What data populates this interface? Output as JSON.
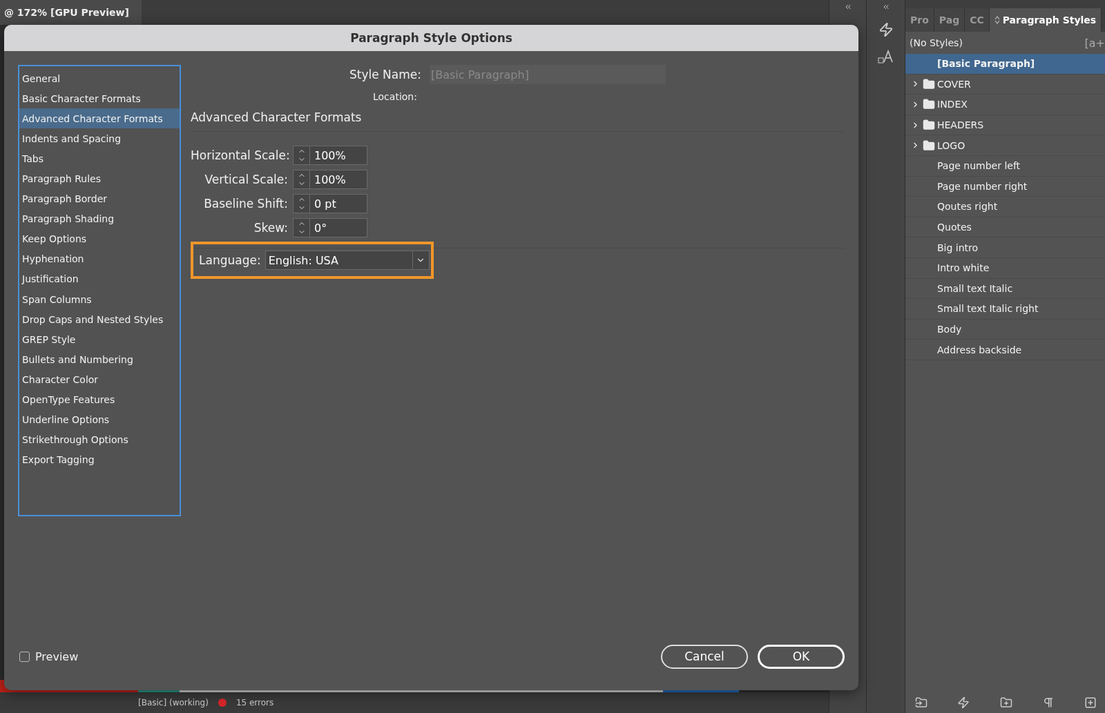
{
  "document_tab": {
    "title": "@ 172% [GPU Preview]"
  },
  "status_bar": {
    "profile": "[Basic] (working)",
    "errors": "15 errors"
  },
  "dialog": {
    "title": "Paragraph Style Options",
    "categories": [
      {
        "label": "General",
        "selected": false
      },
      {
        "label": "Basic Character Formats",
        "selected": false
      },
      {
        "label": "Advanced Character Formats",
        "selected": true
      },
      {
        "label": "Indents and Spacing",
        "selected": false
      },
      {
        "label": "Tabs",
        "selected": false
      },
      {
        "label": "Paragraph Rules",
        "selected": false
      },
      {
        "label": "Paragraph Border",
        "selected": false
      },
      {
        "label": "Paragraph Shading",
        "selected": false
      },
      {
        "label": "Keep Options",
        "selected": false
      },
      {
        "label": "Hyphenation",
        "selected": false
      },
      {
        "label": "Justification",
        "selected": false
      },
      {
        "label": "Span Columns",
        "selected": false
      },
      {
        "label": "Drop Caps and Nested Styles",
        "selected": false
      },
      {
        "label": "GREP Style",
        "selected": false
      },
      {
        "label": "Bullets and Numbering",
        "selected": false
      },
      {
        "label": "Character Color",
        "selected": false
      },
      {
        "label": "OpenType Features",
        "selected": false
      },
      {
        "label": "Underline Options",
        "selected": false
      },
      {
        "label": "Strikethrough Options",
        "selected": false
      },
      {
        "label": "Export Tagging",
        "selected": false
      }
    ],
    "style_name": {
      "label": "Style Name:",
      "value": "[Basic Paragraph]",
      "disabled": true
    },
    "location": {
      "label": "Location:"
    },
    "section_title": "Advanced Character Formats",
    "fields": [
      {
        "label": "Horizontal Scale:",
        "value": "100%"
      },
      {
        "label": "Vertical Scale:",
        "value": "100%"
      },
      {
        "label": "Baseline Shift:",
        "value": "0 pt"
      },
      {
        "label": "Skew:",
        "value": "0°"
      }
    ],
    "language": {
      "label": "Language:",
      "value": "English: USA",
      "highlighted": true
    },
    "preview": {
      "label": "Preview",
      "checked": false
    },
    "buttons": [
      {
        "label": "Cancel",
        "kind": "secondary"
      },
      {
        "label": "OK",
        "kind": "primary"
      }
    ]
  },
  "panel": {
    "tabs": [
      {
        "label": "Pro",
        "selected": false
      },
      {
        "label": "Pag",
        "selected": false
      },
      {
        "label": "CC",
        "selected": false
      },
      {
        "label": "Paragraph Styles",
        "selected": true
      }
    ],
    "header": "(No Styles)",
    "header_badge": "[a+",
    "styles": [
      {
        "label": "[Basic Paragraph]",
        "kind": "style",
        "selected": true
      },
      {
        "label": "COVER",
        "kind": "group",
        "selected": false
      },
      {
        "label": "INDEX",
        "kind": "group",
        "selected": false
      },
      {
        "label": "HEADERS",
        "kind": "group",
        "selected": false
      },
      {
        "label": "LOGO",
        "kind": "group",
        "selected": false
      },
      {
        "label": "Page number left",
        "kind": "style",
        "selected": false
      },
      {
        "label": "Page number right",
        "kind": "style",
        "selected": false
      },
      {
        "label": "Qoutes right",
        "kind": "style",
        "selected": false
      },
      {
        "label": "Quotes",
        "kind": "style",
        "selected": false
      },
      {
        "label": "Big intro",
        "kind": "style",
        "selected": false
      },
      {
        "label": "Intro white",
        "kind": "style",
        "selected": false
      },
      {
        "label": "Small text Italic",
        "kind": "style",
        "selected": false
      },
      {
        "label": "Small text Italic right",
        "kind": "style",
        "selected": false
      },
      {
        "label": "Body",
        "kind": "style",
        "selected": false
      },
      {
        "label": "Address backside",
        "kind": "style",
        "selected": false
      }
    ]
  }
}
